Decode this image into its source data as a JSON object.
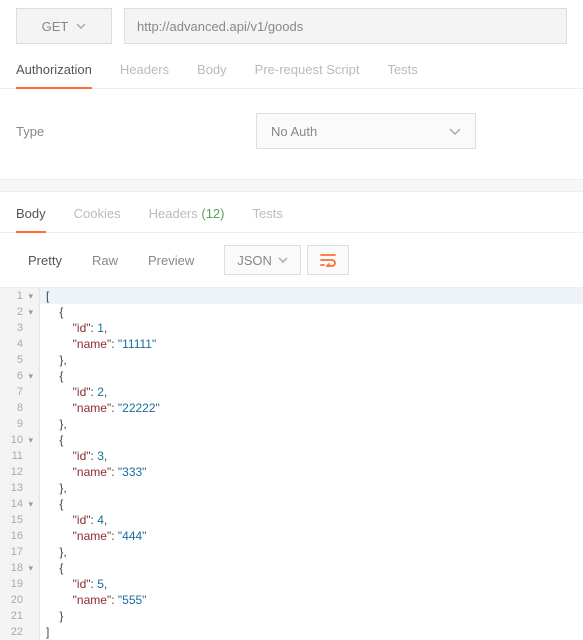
{
  "request": {
    "method": "GET",
    "url": "http://advanced.api/v1/goods"
  },
  "reqTabs": {
    "auth": "Authorization",
    "headers": "Headers",
    "body": "Body",
    "prerequest": "Pre-request Script",
    "tests": "Tests"
  },
  "auth": {
    "typeLabel": "Type",
    "selected": "No Auth"
  },
  "respTabs": {
    "body": "Body",
    "cookies": "Cookies",
    "headers": "Headers",
    "headersCount": "(12)",
    "tests": "Tests"
  },
  "toolbar": {
    "pretty": "Pretty",
    "raw": "Raw",
    "preview": "Preview",
    "format": "JSON"
  },
  "codeLines": [
    {
      "n": 1,
      "fold": true,
      "indent": 0,
      "tokens": [
        {
          "t": "brace",
          "v": "["
        }
      ],
      "hl": true
    },
    {
      "n": 2,
      "fold": true,
      "indent": 1,
      "tokens": [
        {
          "t": "brace",
          "v": "{"
        }
      ]
    },
    {
      "n": 3,
      "fold": false,
      "indent": 2,
      "tokens": [
        {
          "t": "key",
          "v": "\"id\""
        },
        {
          "t": "colon",
          "v": ": "
        },
        {
          "t": "num",
          "v": "1"
        },
        {
          "t": "comma",
          "v": ","
        }
      ]
    },
    {
      "n": 4,
      "fold": false,
      "indent": 2,
      "tokens": [
        {
          "t": "key",
          "v": "\"name\""
        },
        {
          "t": "colon",
          "v": ": "
        },
        {
          "t": "str",
          "v": "\"11111\""
        }
      ]
    },
    {
      "n": 5,
      "fold": false,
      "indent": 1,
      "tokens": [
        {
          "t": "brace",
          "v": "},"
        }
      ]
    },
    {
      "n": 6,
      "fold": true,
      "indent": 1,
      "tokens": [
        {
          "t": "brace",
          "v": "{"
        }
      ]
    },
    {
      "n": 7,
      "fold": false,
      "indent": 2,
      "tokens": [
        {
          "t": "key",
          "v": "\"id\""
        },
        {
          "t": "colon",
          "v": ": "
        },
        {
          "t": "num",
          "v": "2"
        },
        {
          "t": "comma",
          "v": ","
        }
      ]
    },
    {
      "n": 8,
      "fold": false,
      "indent": 2,
      "tokens": [
        {
          "t": "key",
          "v": "\"name\""
        },
        {
          "t": "colon",
          "v": ": "
        },
        {
          "t": "str",
          "v": "\"22222\""
        }
      ]
    },
    {
      "n": 9,
      "fold": false,
      "indent": 1,
      "tokens": [
        {
          "t": "brace",
          "v": "},"
        }
      ]
    },
    {
      "n": 10,
      "fold": true,
      "indent": 1,
      "tokens": [
        {
          "t": "brace",
          "v": "{"
        }
      ]
    },
    {
      "n": 11,
      "fold": false,
      "indent": 2,
      "tokens": [
        {
          "t": "key",
          "v": "\"id\""
        },
        {
          "t": "colon",
          "v": ": "
        },
        {
          "t": "num",
          "v": "3"
        },
        {
          "t": "comma",
          "v": ","
        }
      ]
    },
    {
      "n": 12,
      "fold": false,
      "indent": 2,
      "tokens": [
        {
          "t": "key",
          "v": "\"name\""
        },
        {
          "t": "colon",
          "v": ": "
        },
        {
          "t": "str",
          "v": "\"333\""
        }
      ]
    },
    {
      "n": 13,
      "fold": false,
      "indent": 1,
      "tokens": [
        {
          "t": "brace",
          "v": "},"
        }
      ]
    },
    {
      "n": 14,
      "fold": true,
      "indent": 1,
      "tokens": [
        {
          "t": "brace",
          "v": "{"
        }
      ]
    },
    {
      "n": 15,
      "fold": false,
      "indent": 2,
      "tokens": [
        {
          "t": "key",
          "v": "\"id\""
        },
        {
          "t": "colon",
          "v": ": "
        },
        {
          "t": "num",
          "v": "4"
        },
        {
          "t": "comma",
          "v": ","
        }
      ]
    },
    {
      "n": 16,
      "fold": false,
      "indent": 2,
      "tokens": [
        {
          "t": "key",
          "v": "\"name\""
        },
        {
          "t": "colon",
          "v": ": "
        },
        {
          "t": "str",
          "v": "\"444\""
        }
      ]
    },
    {
      "n": 17,
      "fold": false,
      "indent": 1,
      "tokens": [
        {
          "t": "brace",
          "v": "},"
        }
      ]
    },
    {
      "n": 18,
      "fold": true,
      "indent": 1,
      "tokens": [
        {
          "t": "brace",
          "v": "{"
        }
      ]
    },
    {
      "n": 19,
      "fold": false,
      "indent": 2,
      "tokens": [
        {
          "t": "key",
          "v": "\"id\""
        },
        {
          "t": "colon",
          "v": ": "
        },
        {
          "t": "num",
          "v": "5"
        },
        {
          "t": "comma",
          "v": ","
        }
      ]
    },
    {
      "n": 20,
      "fold": false,
      "indent": 2,
      "tokens": [
        {
          "t": "key",
          "v": "\"name\""
        },
        {
          "t": "colon",
          "v": ": "
        },
        {
          "t": "str",
          "v": "\"555\""
        }
      ]
    },
    {
      "n": 21,
      "fold": false,
      "indent": 1,
      "tokens": [
        {
          "t": "brace",
          "v": "}"
        }
      ]
    },
    {
      "n": 22,
      "fold": false,
      "indent": 0,
      "tokens": [
        {
          "t": "brace",
          "v": "]"
        }
      ]
    }
  ]
}
